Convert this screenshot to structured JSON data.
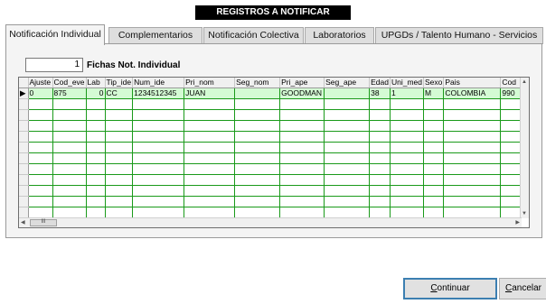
{
  "window": {
    "title": "REGISTROS A NOTIFICAR"
  },
  "tabs": [
    {
      "label": "Notificación Individual"
    },
    {
      "label": "Complementarios"
    },
    {
      "label": "Notificación Colectiva"
    },
    {
      "label": "Laboratorios"
    },
    {
      "label": "UPGDs / Talento Humano - Servicios"
    }
  ],
  "record_count": {
    "value": "1",
    "label": "Fichas Not. Individual"
  },
  "grid": {
    "columns": [
      "Ajuste",
      "Cod_eve",
      "Lab",
      "Tip_ide",
      "Num_ide",
      "Pri_nom",
      "Seg_nom",
      "Pri_ape",
      "Seg_ape",
      "Edad",
      "Uni_med",
      "Sexo",
      "Pais",
      "Cod"
    ],
    "rows": [
      [
        "0",
        "875",
        "0",
        "CC",
        "1234512345",
        "JUAN",
        "",
        "GOODMAN",
        "",
        "38",
        "1",
        "M",
        "COLOMBIA",
        "990"
      ]
    ],
    "row_indicator_icon": "row-pointer-icon",
    "scroll_thumb_label": "III"
  },
  "buttons": {
    "continuar": {
      "mnemonic": "C",
      "rest": "ontinuar"
    },
    "cancelar": {
      "mnemonic": "C",
      "rest": "ancelar"
    }
  },
  "colors": {
    "grid_lines": "#1a9a1a",
    "selected_row": "#d4fbd4",
    "title_bg": "#000000"
  }
}
